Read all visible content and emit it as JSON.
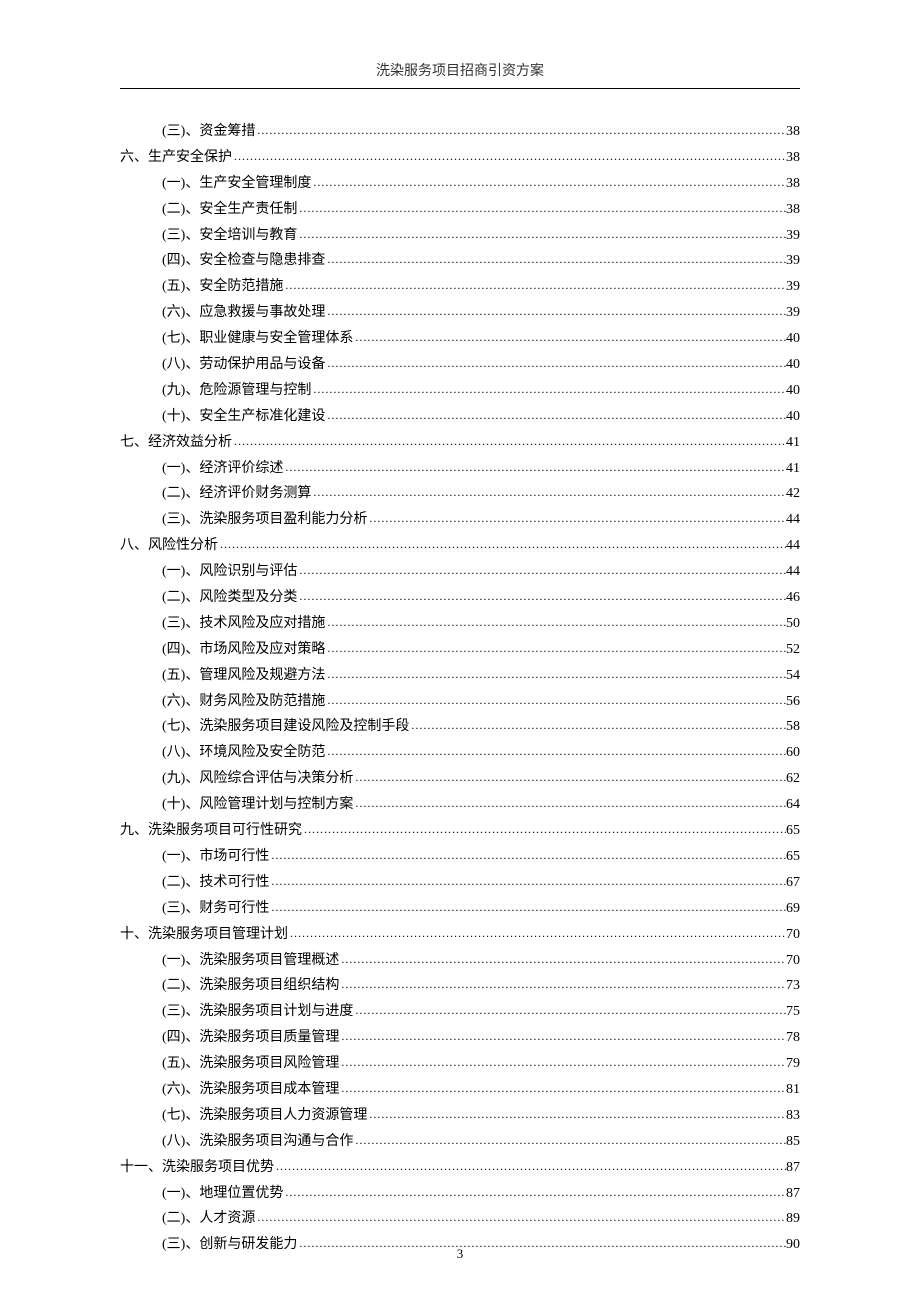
{
  "header": {
    "title": "洗染服务项目招商引资方案"
  },
  "toc": [
    {
      "level": 2,
      "label": "(三)、资金筹措",
      "page": "38"
    },
    {
      "level": 1,
      "label": "六、生产安全保护",
      "page": "38"
    },
    {
      "level": 2,
      "label": "(一)、生产安全管理制度",
      "page": "38"
    },
    {
      "level": 2,
      "label": "(二)、安全生产责任制",
      "page": "38"
    },
    {
      "level": 2,
      "label": "(三)、安全培训与教育",
      "page": "39"
    },
    {
      "level": 2,
      "label": "(四)、安全检查与隐患排查",
      "page": "39"
    },
    {
      "level": 2,
      "label": "(五)、安全防范措施",
      "page": "39"
    },
    {
      "level": 2,
      "label": "(六)、应急救援与事故处理",
      "page": "39"
    },
    {
      "level": 2,
      "label": "(七)、职业健康与安全管理体系",
      "page": "40"
    },
    {
      "level": 2,
      "label": "(八)、劳动保护用品与设备",
      "page": "40"
    },
    {
      "level": 2,
      "label": "(九)、危险源管理与控制",
      "page": "40"
    },
    {
      "level": 2,
      "label": "(十)、安全生产标准化建设",
      "page": "40"
    },
    {
      "level": 1,
      "label": "七、经济效益分析",
      "page": "41"
    },
    {
      "level": 2,
      "label": "(一)、经济评价综述",
      "page": "41"
    },
    {
      "level": 2,
      "label": "(二)、经济评价财务测算",
      "page": "42"
    },
    {
      "level": 2,
      "label": "(三)、洗染服务项目盈利能力分析",
      "page": "44"
    },
    {
      "level": 1,
      "label": "八、风险性分析",
      "page": "44"
    },
    {
      "level": 2,
      "label": "(一)、风险识别与评估",
      "page": "44"
    },
    {
      "level": 2,
      "label": "(二)、风险类型及分类",
      "page": "46"
    },
    {
      "level": 2,
      "label": "(三)、技术风险及应对措施",
      "page": "50"
    },
    {
      "level": 2,
      "label": "(四)、市场风险及应对策略",
      "page": "52"
    },
    {
      "level": 2,
      "label": "(五)、管理风险及规避方法",
      "page": "54"
    },
    {
      "level": 2,
      "label": "(六)、财务风险及防范措施",
      "page": "56"
    },
    {
      "level": 2,
      "label": "(七)、洗染服务项目建设风险及控制手段",
      "page": "58"
    },
    {
      "level": 2,
      "label": "(八)、环境风险及安全防范",
      "page": "60"
    },
    {
      "level": 2,
      "label": "(九)、风险综合评估与决策分析",
      "page": "62"
    },
    {
      "level": 2,
      "label": "(十)、风险管理计划与控制方案",
      "page": "64"
    },
    {
      "level": 1,
      "label": "九、洗染服务项目可行性研究",
      "page": "65"
    },
    {
      "level": 2,
      "label": "(一)、市场可行性",
      "page": "65"
    },
    {
      "level": 2,
      "label": "(二)、技术可行性",
      "page": "67"
    },
    {
      "level": 2,
      "label": "(三)、财务可行性",
      "page": "69"
    },
    {
      "level": 1,
      "label": "十、洗染服务项目管理计划",
      "page": "70"
    },
    {
      "level": 2,
      "label": "(一)、洗染服务项目管理概述",
      "page": "70"
    },
    {
      "level": 2,
      "label": "(二)、洗染服务项目组织结构",
      "page": "73"
    },
    {
      "level": 2,
      "label": "(三)、洗染服务项目计划与进度",
      "page": "75"
    },
    {
      "level": 2,
      "label": "(四)、洗染服务项目质量管理",
      "page": "78"
    },
    {
      "level": 2,
      "label": "(五)、洗染服务项目风险管理",
      "page": "79"
    },
    {
      "level": 2,
      "label": "(六)、洗染服务项目成本管理",
      "page": "81"
    },
    {
      "level": 2,
      "label": "(七)、洗染服务项目人力资源管理",
      "page": "83"
    },
    {
      "level": 2,
      "label": "(八)、洗染服务项目沟通与合作",
      "page": "85"
    },
    {
      "level": 1,
      "label": "十一、洗染服务项目优势",
      "page": "87"
    },
    {
      "level": 2,
      "label": "(一)、地理位置优势",
      "page": "87"
    },
    {
      "level": 2,
      "label": "(二)、人才资源",
      "page": "89"
    },
    {
      "level": 2,
      "label": "(三)、创新与研发能力",
      "page": "90"
    }
  ],
  "page_number": "3"
}
